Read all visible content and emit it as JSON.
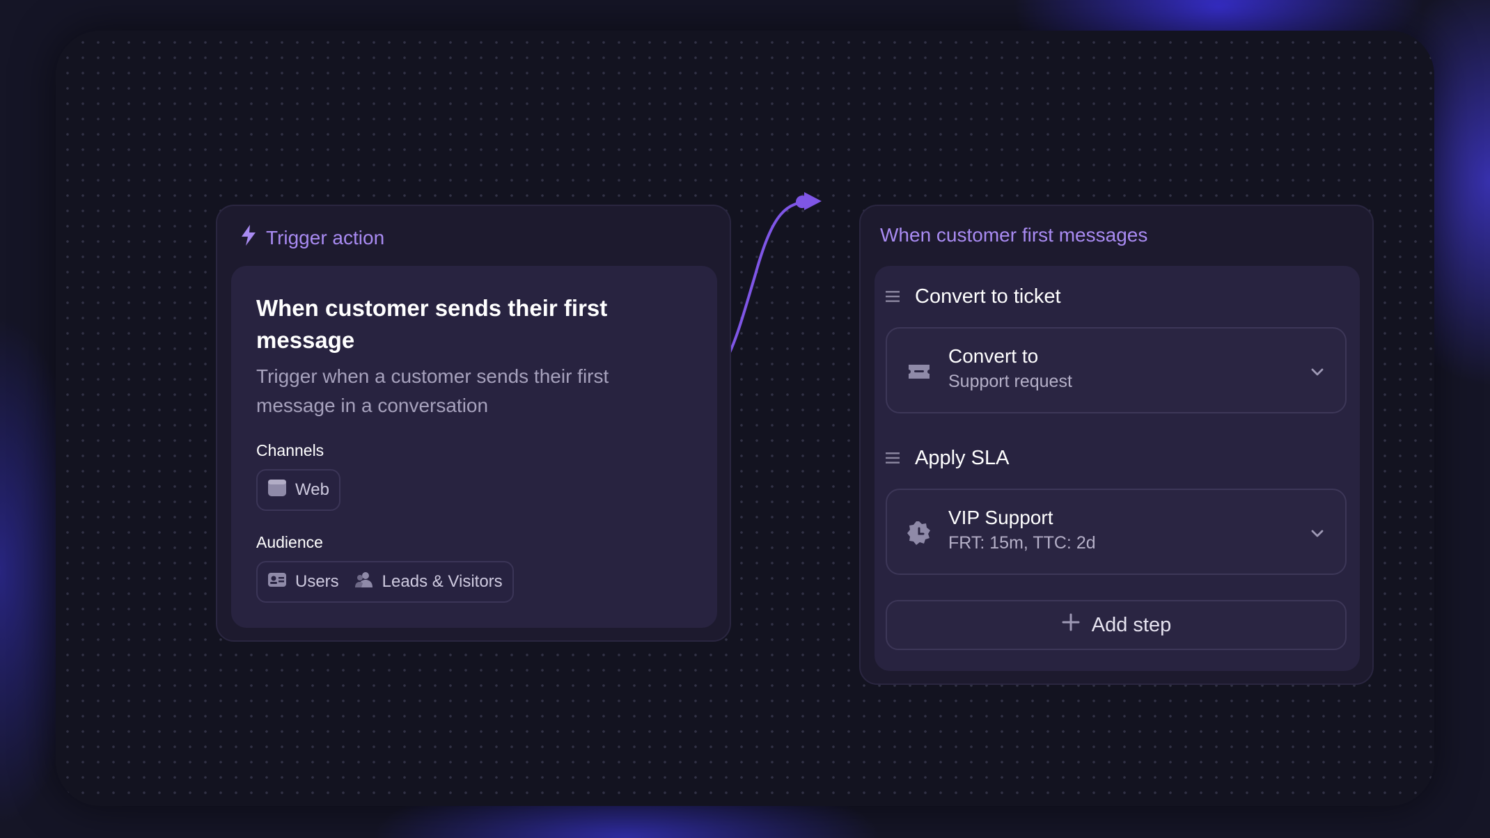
{
  "colors": {
    "accent": "#a98bf2",
    "connector": "#7f56e6",
    "card": "#1d1a2e",
    "inner": "#282340"
  },
  "trigger_node": {
    "header": "Trigger action",
    "header_icon": "lightning-icon",
    "title": "When customer sends their first message",
    "description": "Trigger when a customer sends their first message in a conversation",
    "channels_label": "Channels",
    "channels": [
      {
        "label": "Web",
        "icon": "browser-window-icon"
      }
    ],
    "audience_label": "Audience",
    "audience": [
      {
        "label": "Users",
        "icon": "id-card-icon"
      },
      {
        "label": "Leads & Visitors",
        "icon": "people-icon"
      }
    ]
  },
  "action_node": {
    "header": "When customer first messages",
    "steps": [
      {
        "heading": "Convert to ticket",
        "title": "Convert to",
        "value": "Support request",
        "icon": "ticket-icon"
      },
      {
        "heading": "Apply SLA",
        "title": "VIP Support",
        "value": "FRT: 15m, TTC: 2d",
        "icon": "clock-badge-icon"
      }
    ],
    "add_step_label": "Add step"
  }
}
